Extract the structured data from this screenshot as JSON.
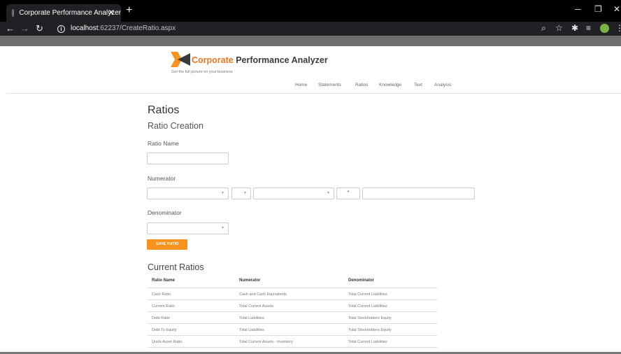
{
  "browser": {
    "tab_title": "Corporate Performance Analyzer",
    "tab_close": "✕",
    "new_tab": "+",
    "window_controls": [
      "─",
      "❐",
      "✕"
    ],
    "url_host": "localhost",
    "url_rest": ":62237/CreateRatio.aspx",
    "info_symbol": "i"
  },
  "site": {
    "brand_part1": "Corporate",
    "brand_part2": " Performance Analyzer",
    "tagline": "Get the full picture on your business",
    "brand_colors": {
      "orange": "#e87722",
      "dark": "#3a3a3a"
    },
    "nav": [
      "Home",
      "Statements",
      "Ratios",
      "Knowledge",
      "Text",
      "Analysis"
    ]
  },
  "page": {
    "title": "Ratios",
    "subtitle": "Ratio Creation",
    "ratio_name_label": "Ratio Name",
    "ratio_name_value": "",
    "numerator_label": "Numerator",
    "numerator_select1": "",
    "numerator_operator1": "",
    "numerator_select2": "",
    "numerator_operator2": "*",
    "numerator_value": "",
    "denominator_label": "Denominator",
    "denominator_select": "",
    "save_button": "SAVE RATIO",
    "save_button_color": "#f7931e"
  },
  "current_ratios": {
    "title": "Current Ratios",
    "columns": [
      "Ratio Name",
      "Numerator",
      "Denominator"
    ],
    "rows": [
      [
        "Cash Ratio",
        "Cash and Cash Equivalents",
        "Total Current Liabilities"
      ],
      [
        "Current Ratio",
        "Total Current Assets",
        "Total Current Liabilities"
      ],
      [
        "Debt Ratio",
        "Total Liabilities",
        "Total Stockholders Equity"
      ],
      [
        "Debt To Equity",
        "Total Liabilities",
        "Total Stockholders Equity"
      ],
      [
        "Quick Asset Ratio",
        "Total Current Assets - Inventory",
        "Total Current Liabilities"
      ]
    ]
  }
}
